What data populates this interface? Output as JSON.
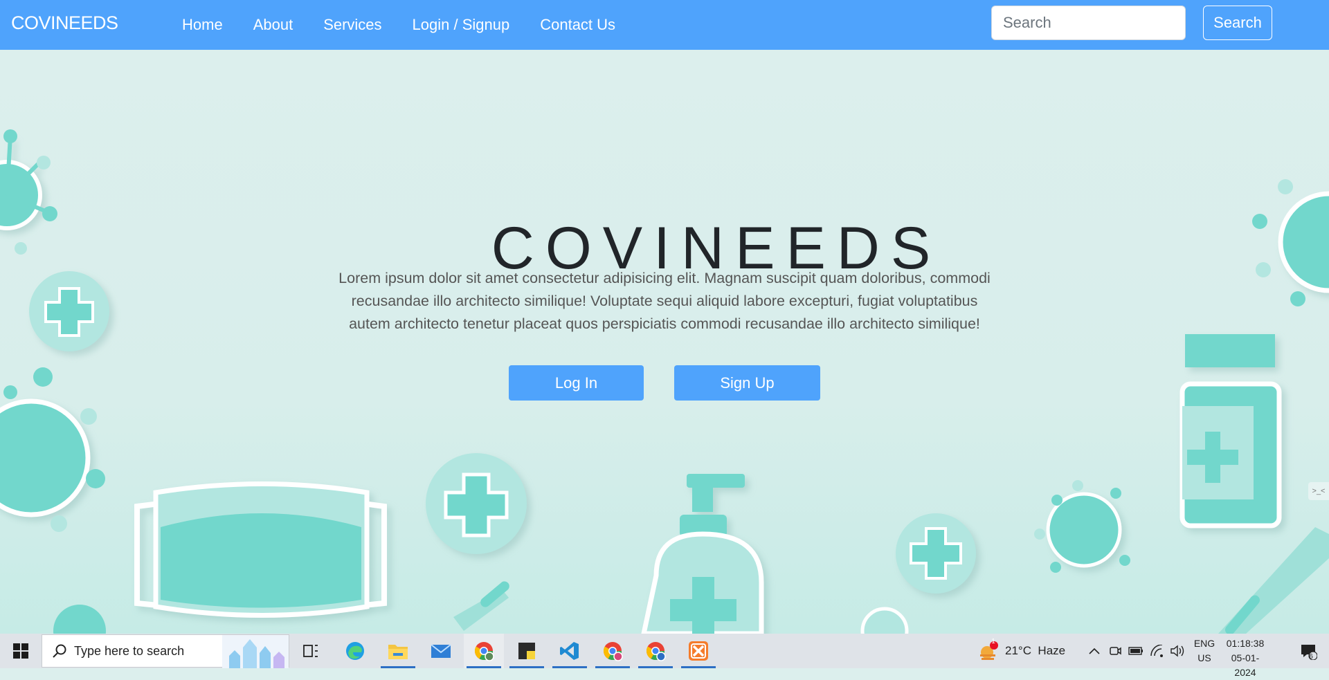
{
  "navbar": {
    "brand": "COVINEEDS",
    "links": [
      "Home",
      "About",
      "Services",
      "Login / Signup",
      "Contact Us"
    ],
    "search_placeholder": "Search",
    "search_button": "Search",
    "background": "#4fa3fc"
  },
  "hero": {
    "title": "COVINEEDS",
    "text": "Lorem ipsum dolor sit amet consectetur adipisicing elit. Magnam suscipit quam doloribus, commodi recusandae illo architecto similique! Voluptate sequi aliquid labore excepturi, fugiat voluptatibus autem architecto tenetur placeat quos perspiciatis commodi recusandae illo architecto similique!",
    "login_button": "Log In",
    "signup_button": "Sign Up",
    "accent": "#72d7cc",
    "side_handle": ">_<"
  },
  "taskbar": {
    "search_placeholder": "Type here to search",
    "weather": "21°C  Haze",
    "weather_badge": "1",
    "lang_top": "ENG",
    "lang_bottom": "US",
    "time": "01:18:38",
    "date": "05-01-2024",
    "notification_count": "6",
    "apps": [
      "task-view",
      "edge",
      "file-explorer",
      "mail",
      "chrome",
      "sticky-notes",
      "vscode",
      "chrome-profile-s",
      "chrome-profile-a",
      "xampp"
    ]
  }
}
